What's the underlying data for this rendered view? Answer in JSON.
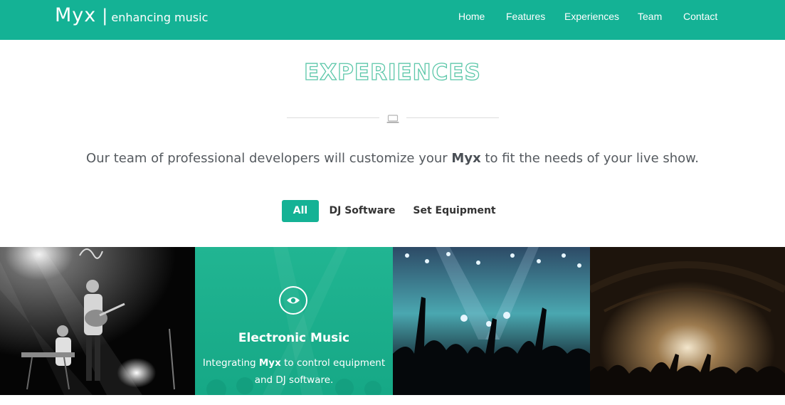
{
  "brand": {
    "name": "Myx",
    "separator": "|",
    "tagline": "enhancing music"
  },
  "nav": [
    {
      "label": "Home"
    },
    {
      "label": "Features"
    },
    {
      "label": "Experiences"
    },
    {
      "label": "Team"
    },
    {
      "label": "Contact"
    }
  ],
  "section": {
    "title": "EXPERIENCES",
    "divider_icon": "laptop-icon",
    "intro_before": "Our team of professional developers will customize your ",
    "intro_bold": "Myx",
    "intro_after": " to fit the needs of your live show."
  },
  "filters": [
    {
      "label": "All",
      "active": true
    },
    {
      "label": "DJ Software",
      "active": false
    },
    {
      "label": "Set Equipment",
      "active": false
    }
  ],
  "gallery": [
    {
      "photo": "band-on-stage-bw"
    },
    {
      "photo": "crowd-concert-teal",
      "overlay_icon": "eye-icon",
      "title": "Electronic Music",
      "desc_before": "Integrating ",
      "desc_bold": "Myx",
      "desc_after": " to control equipment and DJ software."
    },
    {
      "photo": "crowd-hands-stage-lights"
    },
    {
      "photo": "concert-hall-sepia"
    }
  ],
  "colors": {
    "accent": "#14b295",
    "title_outline": "#5cc7a9",
    "text": "#555a5f"
  }
}
